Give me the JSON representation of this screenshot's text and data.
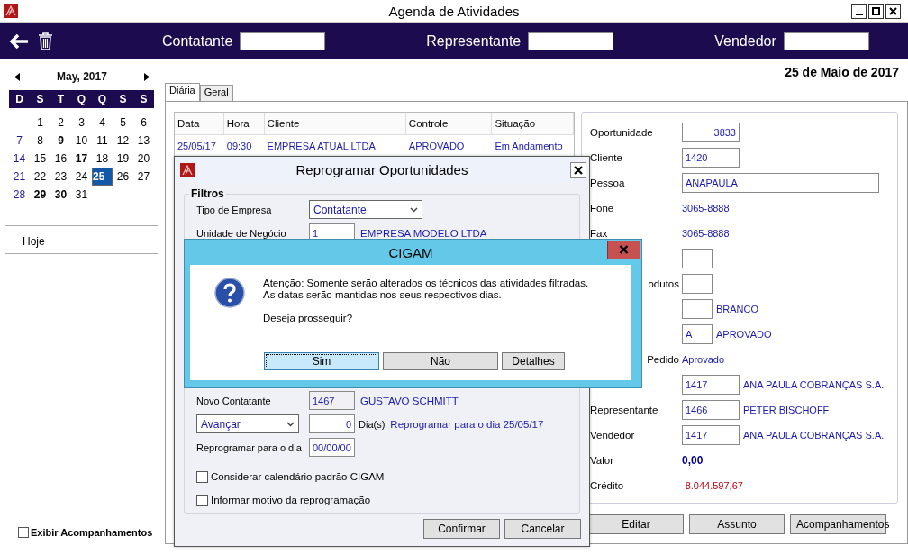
{
  "window": {
    "title": "Agenda de Atividades"
  },
  "toolbar": {
    "filters": [
      {
        "label": "Contatante"
      },
      {
        "label": "Representante"
      },
      {
        "label": "Vendedor"
      }
    ]
  },
  "calendar": {
    "month": "May, 2017",
    "weekdays": [
      "D",
      "S",
      "T",
      "Q",
      "Q",
      "S",
      "S"
    ],
    "weeks": [
      [
        {
          "day": "1",
          "bold": false,
          "selected": false
        },
        {
          "day": "2",
          "bold": false,
          "selected": false
        },
        {
          "day": "3",
          "bold": false,
          "selected": false
        },
        {
          "day": "4",
          "bold": false,
          "selected": false
        },
        {
          "day": "5",
          "bold": false,
          "selected": false
        },
        {
          "day": "6",
          "bold": false,
          "selected": false
        }
      ],
      [
        {
          "day": "7",
          "bold": false,
          "selected": false
        },
        {
          "day": "8",
          "bold": false,
          "selected": false
        },
        {
          "day": "9",
          "bold": true,
          "selected": false
        },
        {
          "day": "10",
          "bold": false,
          "selected": false
        },
        {
          "day": "11",
          "bold": false,
          "selected": false
        },
        {
          "day": "12",
          "bold": false,
          "selected": false
        },
        {
          "day": "13",
          "bold": false,
          "selected": false
        }
      ],
      [
        {
          "day": "14",
          "bold": false,
          "selected": false
        },
        {
          "day": "15",
          "bold": false,
          "selected": false
        },
        {
          "day": "16",
          "bold": false,
          "selected": false
        },
        {
          "day": "17",
          "bold": true,
          "selected": false
        },
        {
          "day": "18",
          "bold": false,
          "selected": false
        },
        {
          "day": "19",
          "bold": false,
          "selected": false
        },
        {
          "day": "20",
          "bold": false,
          "selected": false
        }
      ],
      [
        {
          "day": "21",
          "bold": false,
          "selected": false
        },
        {
          "day": "22",
          "bold": false,
          "selected": false
        },
        {
          "day": "23",
          "bold": false,
          "selected": false
        },
        {
          "day": "24",
          "bold": false,
          "selected": false
        },
        {
          "day": "25",
          "bold": true,
          "selected": true
        },
        {
          "day": "26",
          "bold": false,
          "selected": false
        },
        {
          "day": "27",
          "bold": false,
          "selected": false
        }
      ],
      [
        {
          "day": "28",
          "bold": false,
          "selected": false
        },
        {
          "day": "29",
          "bold": true,
          "selected": false
        },
        {
          "day": "30",
          "bold": true,
          "selected": false
        },
        {
          "day": "31",
          "bold": false,
          "selected": false
        }
      ]
    ]
  },
  "today_link": "Hoje",
  "show_followups": {
    "label": "Exibir Acompanhamentos",
    "checked": false
  },
  "current_date": "25 de Maio de 2017",
  "tabs": [
    {
      "label": "Diária",
      "selected": true
    },
    {
      "label": "Geral",
      "selected": false
    }
  ],
  "table": {
    "columns": [
      "Data",
      "Hora",
      "Cliente",
      "Controle",
      "Situação"
    ],
    "rows": [
      [
        "25/05/17",
        "09:30",
        "EMPRESA ATUAL LTDA",
        "APROVADO",
        "Em Andamento"
      ]
    ]
  },
  "details": [
    {
      "label": "Oportunidade",
      "field": {
        "value": "3833",
        "kind": "number"
      }
    },
    {
      "label": "Cliente",
      "field": {
        "value": "1420",
        "kind": "code"
      }
    },
    {
      "label": "Pessoa",
      "field": {
        "value": "ANAPAULA",
        "kind": "name"
      }
    },
    {
      "label": "Fone",
      "text": "3065-8888",
      "kind": "plain"
    },
    {
      "label": "Fax",
      "text": "3065-8888",
      "kind": "plain"
    },
    {
      "field": {
        "kind": "flag"
      }
    },
    {
      "label": "odutos",
      "label_cut": true,
      "field": {
        "kind": "flag"
      }
    },
    {
      "field": {
        "kind": "flag"
      },
      "text": "BRANCO",
      "kind": "plain"
    },
    {
      "field": {
        "value": "A",
        "kind": "flag"
      },
      "text": "APROVADO",
      "kind": "plain"
    },
    {
      "label": "Pedido",
      "label_cut": true,
      "text": "Aprovado",
      "kind": "plain"
    },
    {
      "field": {
        "value": "1417",
        "kind": "code"
      },
      "text": "ANA PAULA COBRANÇAS S.A.",
      "kind": "plain"
    },
    {
      "label": "Representante",
      "field": {
        "value": "1466",
        "kind": "code"
      },
      "text": "PETER BISCHOFF",
      "kind": "plain"
    },
    {
      "label": "Vendedor",
      "field": {
        "value": "1417",
        "kind": "code"
      },
      "text": "ANA PAULA COBRANÇAS S.A.",
      "kind": "plain"
    },
    {
      "label": "Valor",
      "text": "0,00",
      "kind": "bold"
    },
    {
      "label": "Crédito",
      "text": "-8.044.597,67",
      "kind": "negative"
    }
  ],
  "detail_buttons": [
    "Editar",
    "Assunto",
    "Acompanhamentos"
  ],
  "reschedule_dialog": {
    "title": "Reprogramar Oportunidades",
    "group": "Filtros",
    "company_type": {
      "label": "Tipo de Empresa",
      "value": "Contatante"
    },
    "business_unit": {
      "label": "Unidade de Negócio",
      "code": "1",
      "name": "EMPRESA MODELO LTDA"
    },
    "new_contact": {
      "label": "Novo Contatante",
      "code": "1467",
      "name": "GUSTAVO SCHMITT"
    },
    "shift": {
      "mode": "Avançar",
      "days": "0",
      "unit": "Dia(s)",
      "note": "Reprogramar para o dia 25/05/17"
    },
    "reschedule_to": {
      "label": "Reprogramar para o dia",
      "value": "00/00/00"
    },
    "options": [
      {
        "label": "Considerar calendário padrão CIGAM",
        "checked": false
      },
      {
        "label": "Informar motivo da reprogramação",
        "checked": false
      }
    ],
    "buttons": [
      "Confirmar",
      "Cancelar"
    ]
  },
  "message_box": {
    "title": "CIGAM",
    "lines": [
      "Atenção: Somente serão alterados os técnicos das atividades filtradas.",
      "As datas serão mantidas nos seus respectivos dias.",
      "Deseja prosseguir?"
    ],
    "buttons": [
      {
        "label": "Sim",
        "selected": true
      },
      {
        "label": "Não",
        "selected": false
      },
      {
        "label": "Detalhes",
        "selected": false
      }
    ]
  }
}
